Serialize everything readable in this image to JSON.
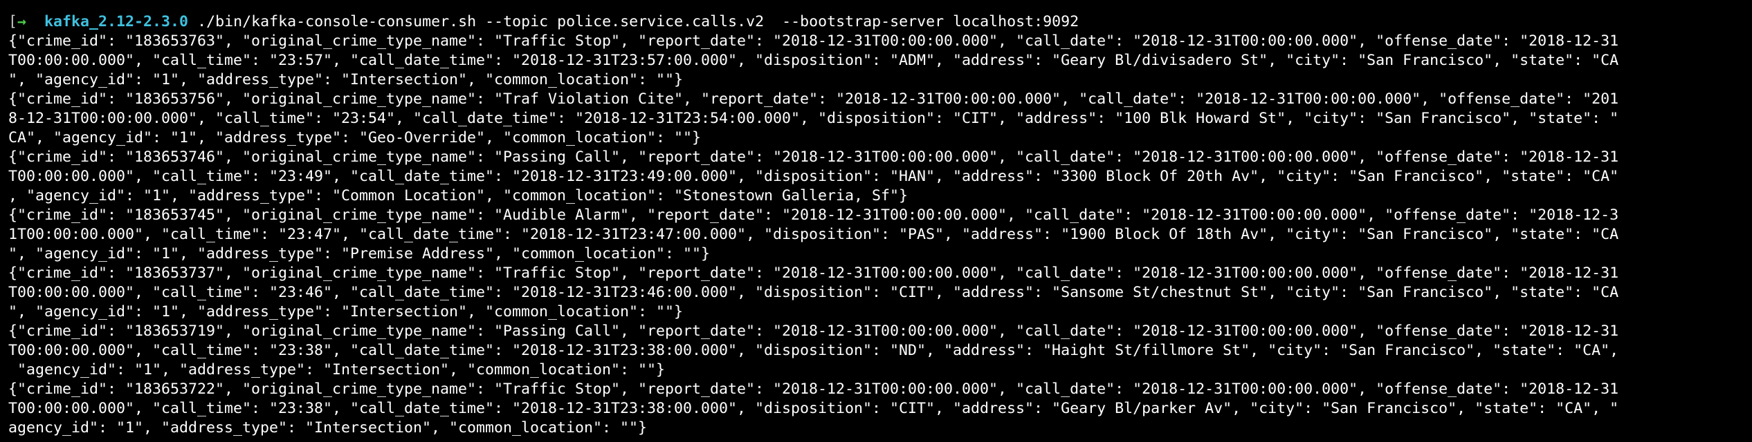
{
  "terminal": {
    "prompt": {
      "bracket": "[",
      "arrow": "→",
      "directory": "kafka_2.12-2.3.0",
      "command": "./bin/kafka-console-consumer.sh --topic police.service.calls.v2  --bootstrap-server localhost:9092"
    },
    "output_lines": [
      "{\"crime_id\": \"183653763\", \"original_crime_type_name\": \"Traffic Stop\", \"report_date\": \"2018-12-31T00:00:00.000\", \"call_date\": \"2018-12-31T00:00:00.000\", \"offense_date\": \"2018-12-31",
      "T00:00:00.000\", \"call_time\": \"23:57\", \"call_date_time\": \"2018-12-31T23:57:00.000\", \"disposition\": \"ADM\", \"address\": \"Geary Bl/divisadero St\", \"city\": \"San Francisco\", \"state\": \"CA",
      "\", \"agency_id\": \"1\", \"address_type\": \"Intersection\", \"common_location\": \"\"}",
      "{\"crime_id\": \"183653756\", \"original_crime_type_name\": \"Traf Violation Cite\", \"report_date\": \"2018-12-31T00:00:00.000\", \"call_date\": \"2018-12-31T00:00:00.000\", \"offense_date\": \"201",
      "8-12-31T00:00:00.000\", \"call_time\": \"23:54\", \"call_date_time\": \"2018-12-31T23:54:00.000\", \"disposition\": \"CIT\", \"address\": \"100 Blk Howard St\", \"city\": \"San Francisco\", \"state\": \"",
      "CA\", \"agency_id\": \"1\", \"address_type\": \"Geo-Override\", \"common_location\": \"\"}",
      "{\"crime_id\": \"183653746\", \"original_crime_type_name\": \"Passing Call\", \"report_date\": \"2018-12-31T00:00:00.000\", \"call_date\": \"2018-12-31T00:00:00.000\", \"offense_date\": \"2018-12-31",
      "T00:00:00.000\", \"call_time\": \"23:49\", \"call_date_time\": \"2018-12-31T23:49:00.000\", \"disposition\": \"HAN\", \"address\": \"3300 Block Of 20th Av\", \"city\": \"San Francisco\", \"state\": \"CA\"",
      ", \"agency_id\": \"1\", \"address_type\": \"Common Location\", \"common_location\": \"Stonestown Galleria, Sf\"}",
      "{\"crime_id\": \"183653745\", \"original_crime_type_name\": \"Audible Alarm\", \"report_date\": \"2018-12-31T00:00:00.000\", \"call_date\": \"2018-12-31T00:00:00.000\", \"offense_date\": \"2018-12-3",
      "1T00:00:00.000\", \"call_time\": \"23:47\", \"call_date_time\": \"2018-12-31T23:47:00.000\", \"disposition\": \"PAS\", \"address\": \"1900 Block Of 18th Av\", \"city\": \"San Francisco\", \"state\": \"CA",
      "\", \"agency_id\": \"1\", \"address_type\": \"Premise Address\", \"common_location\": \"\"}",
      "{\"crime_id\": \"183653737\", \"original_crime_type_name\": \"Traffic Stop\", \"report_date\": \"2018-12-31T00:00:00.000\", \"call_date\": \"2018-12-31T00:00:00.000\", \"offense_date\": \"2018-12-31",
      "T00:00:00.000\", \"call_time\": \"23:46\", \"call_date_time\": \"2018-12-31T23:46:00.000\", \"disposition\": \"CIT\", \"address\": \"Sansome St/chestnut St\", \"city\": \"San Francisco\", \"state\": \"CA",
      "\", \"agency_id\": \"1\", \"address_type\": \"Intersection\", \"common_location\": \"\"}",
      "{\"crime_id\": \"183653719\", \"original_crime_type_name\": \"Passing Call\", \"report_date\": \"2018-12-31T00:00:00.000\", \"call_date\": \"2018-12-31T00:00:00.000\", \"offense_date\": \"2018-12-31",
      "T00:00:00.000\", \"call_time\": \"23:38\", \"call_date_time\": \"2018-12-31T23:38:00.000\", \"disposition\": \"ND\", \"address\": \"Haight St/fillmore St\", \"city\": \"San Francisco\", \"state\": \"CA\",",
      " \"agency_id\": \"1\", \"address_type\": \"Intersection\", \"common_location\": \"\"}",
      "{\"crime_id\": \"183653722\", \"original_crime_type_name\": \"Traffic Stop\", \"report_date\": \"2018-12-31T00:00:00.000\", \"call_date\": \"2018-12-31T00:00:00.000\", \"offense_date\": \"2018-12-31",
      "T00:00:00.000\", \"call_time\": \"23:38\", \"call_date_time\": \"2018-12-31T23:38:00.000\", \"disposition\": \"CIT\", \"address\": \"Geary Bl/parker Av\", \"city\": \"San Francisco\", \"state\": \"CA\", \"",
      "agency_id\": \"1\", \"address_type\": \"Intersection\", \"common_location\": \"\"}"
    ]
  }
}
